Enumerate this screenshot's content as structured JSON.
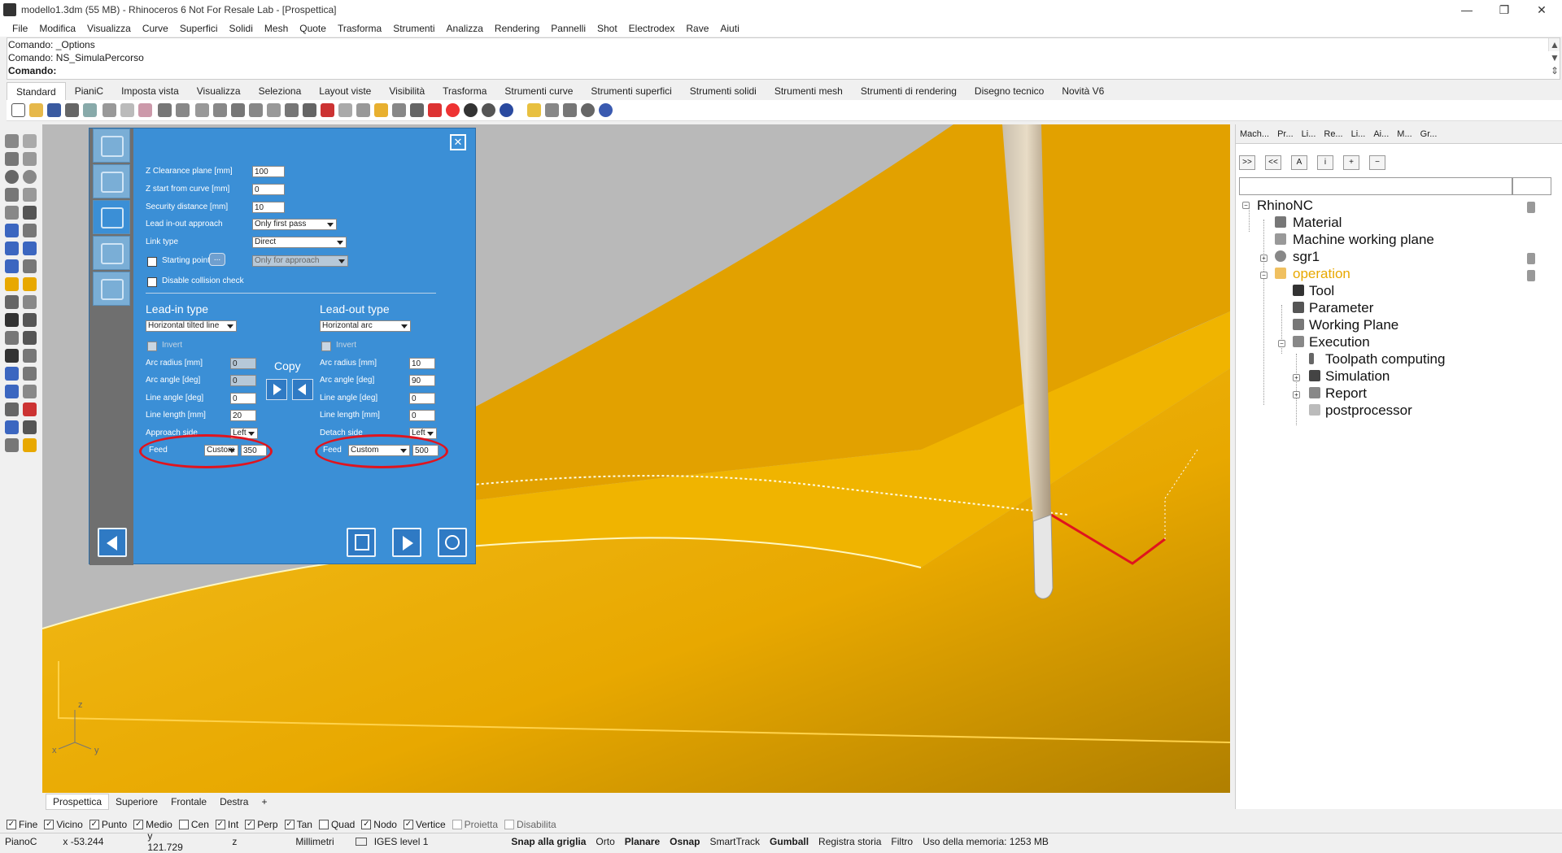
{
  "window": {
    "title": "modello1.3dm (55 MB) - Rhinoceros 6 Not For Resale Lab - [Prospettica]",
    "controls": [
      "—",
      "❐",
      "✕"
    ]
  },
  "menu": [
    "File",
    "Modifica",
    "Visualizza",
    "Curve",
    "Superfici",
    "Solidi",
    "Mesh",
    "Quote",
    "Trasforma",
    "Strumenti",
    "Analizza",
    "Rendering",
    "Pannelli",
    "Shot",
    "Electrodex",
    "Rave",
    "Aiuti"
  ],
  "command": {
    "lines": [
      "Comando: _Options",
      "Comando: NS_SimulaPercorso"
    ],
    "prompt": "Comando:"
  },
  "toolbar_tabs": [
    "Standard",
    "PianiC",
    "Imposta vista",
    "Visualizza",
    "Seleziona",
    "Layout viste",
    "Visibilità",
    "Trasforma",
    "Strumenti curve",
    "Strumenti superfici",
    "Strumenti solidi",
    "Strumenti mesh",
    "Strumenti di rendering",
    "Disegno tecnico",
    "Novità V6"
  ],
  "dialog": {
    "close": "✕",
    "fields": [
      {
        "label": "Z Clearance plane [mm]",
        "value": "100"
      },
      {
        "label": "Z start from curve [mm]",
        "value": "0"
      },
      {
        "label": "Security distance [mm]",
        "value": "10"
      }
    ],
    "lead_approach": {
      "label": "Lead in-out approach",
      "value": "Only first pass"
    },
    "link_type": {
      "label": "Link type",
      "value": "Direct"
    },
    "starting_point": {
      "label": "Starting point",
      "button": "...",
      "value": "Only for approach"
    },
    "disable_collision": "Disable collision check",
    "lead_in": {
      "title": "Lead-in type",
      "type": "Horizontal tilted line",
      "invert": "Invert",
      "arc_radius": {
        "label": "Arc radius [mm]",
        "value": "0"
      },
      "arc_angle": {
        "label": "Arc angle [deg]",
        "value": "0"
      },
      "line_angle": {
        "label": "Line angle [deg]",
        "value": "0"
      },
      "line_length": {
        "label": "Line length [mm]",
        "value": "20"
      },
      "side": {
        "label": "Approach side",
        "value": "Left"
      },
      "feed": {
        "label": "Feed",
        "mode": "Custom",
        "value": "350"
      }
    },
    "lead_out": {
      "title": "Lead-out type",
      "type": "Horizontal arc",
      "invert": "Invert",
      "arc_radius": {
        "label": "Arc radius [mm]",
        "value": "10"
      },
      "arc_angle": {
        "label": "Arc angle [deg]",
        "value": "90"
      },
      "line_angle": {
        "label": "Line angle [deg]",
        "value": "0"
      },
      "line_length": {
        "label": "Line length [mm]",
        "value": "0"
      },
      "side": {
        "label": "Detach side",
        "value": "Left"
      },
      "feed": {
        "label": "Feed",
        "mode": "Custom",
        "value": "500"
      }
    },
    "copy_label": "Copy"
  },
  "right_panel": {
    "tabs": [
      "Mach...",
      "Pr...",
      "Li...",
      "Re...",
      "Li...",
      "Ai...",
      "M...",
      "Gr..."
    ],
    "buttons": [
      ">>",
      "<<",
      "A",
      "i",
      "+",
      "−"
    ],
    "tree": [
      {
        "label": "RhinoNC"
      },
      {
        "label": "Material"
      },
      {
        "label": "Machine working plane"
      },
      {
        "label": "sgr1"
      },
      {
        "label": "operation"
      },
      {
        "label": "Tool"
      },
      {
        "label": "Parameter"
      },
      {
        "label": "Working Plane"
      },
      {
        "label": "Execution"
      },
      {
        "label": "Toolpath computing"
      },
      {
        "label": "Simulation"
      },
      {
        "label": "Report"
      },
      {
        "label": "postprocessor"
      }
    ]
  },
  "axes": {
    "z": "z",
    "x": "x",
    "y": "y"
  },
  "viewport_tabs": [
    "Prospettica",
    "Superiore",
    "Frontale",
    "Destra",
    "+"
  ],
  "osnaps": [
    {
      "label": "Fine",
      "checked": true
    },
    {
      "label": "Vicino",
      "checked": true
    },
    {
      "label": "Punto",
      "checked": true
    },
    {
      "label": "Medio",
      "checked": true
    },
    {
      "label": "Cen",
      "checked": false
    },
    {
      "label": "Int",
      "checked": true
    },
    {
      "label": "Perp",
      "checked": true
    },
    {
      "label": "Tan",
      "checked": true
    },
    {
      "label": "Quad",
      "checked": false
    },
    {
      "label": "Nodo",
      "checked": true
    },
    {
      "label": "Vertice",
      "checked": true
    },
    {
      "label": "Proietta",
      "checked": false
    },
    {
      "label": "Disabilita",
      "checked": false
    }
  ],
  "status": {
    "cplane": "PianoC",
    "x": "x -53.244",
    "y": "y 121.729",
    "z": "z",
    "units": "Millimetri",
    "layer": "IGES level 1",
    "snap": "Snap alla griglia",
    "ortho": "Orto",
    "planar": "Planare",
    "osnap": "Osnap",
    "smarttrack": "SmartTrack",
    "gumball": "Gumball",
    "history": "Registra storia",
    "filter": "Filtro",
    "memory": "Uso della memoria: 1253 MB"
  },
  "colors": {
    "surface": "#e8a800",
    "dialog": "#3b8fd6",
    "highlight": "#e0141e",
    "selected_tree": "#e8a800"
  }
}
